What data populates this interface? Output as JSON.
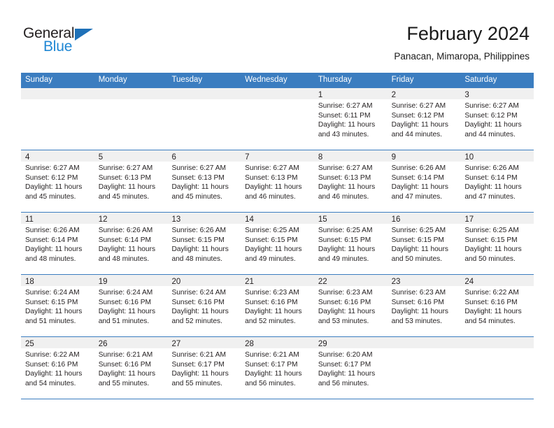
{
  "brand": {
    "name_part1": "General",
    "name_part2": "Blue",
    "triangle_color": "#1f71b8",
    "blue_color": "#1f87d4"
  },
  "header": {
    "title": "February 2024",
    "subtitle": "Panacan, Mimaropa, Philippines"
  },
  "theme": {
    "header_row_bg": "#3b7dc0",
    "day_band_bg": "#f0f0f0",
    "grid_line": "#3b7dc0",
    "text": "#231f20"
  },
  "weekdays": [
    "Sunday",
    "Monday",
    "Tuesday",
    "Wednesday",
    "Thursday",
    "Friday",
    "Saturday"
  ],
  "labels": {
    "sunrise_prefix": "Sunrise:",
    "sunset_prefix": "Sunset:",
    "daylight_prefix": "Daylight:"
  },
  "weeks": [
    [
      {
        "day": "",
        "empty": true
      },
      {
        "day": "",
        "empty": true
      },
      {
        "day": "",
        "empty": true
      },
      {
        "day": "",
        "empty": true
      },
      {
        "day": "1",
        "sunrise": "Sunrise: 6:27 AM",
        "sunset": "Sunset: 6:11 PM",
        "daylight1": "Daylight: 11 hours",
        "daylight2": "and 43 minutes."
      },
      {
        "day": "2",
        "sunrise": "Sunrise: 6:27 AM",
        "sunset": "Sunset: 6:12 PM",
        "daylight1": "Daylight: 11 hours",
        "daylight2": "and 44 minutes."
      },
      {
        "day": "3",
        "sunrise": "Sunrise: 6:27 AM",
        "sunset": "Sunset: 6:12 PM",
        "daylight1": "Daylight: 11 hours",
        "daylight2": "and 44 minutes."
      }
    ],
    [
      {
        "day": "4",
        "sunrise": "Sunrise: 6:27 AM",
        "sunset": "Sunset: 6:12 PM",
        "daylight1": "Daylight: 11 hours",
        "daylight2": "and 45 minutes."
      },
      {
        "day": "5",
        "sunrise": "Sunrise: 6:27 AM",
        "sunset": "Sunset: 6:13 PM",
        "daylight1": "Daylight: 11 hours",
        "daylight2": "and 45 minutes."
      },
      {
        "day": "6",
        "sunrise": "Sunrise: 6:27 AM",
        "sunset": "Sunset: 6:13 PM",
        "daylight1": "Daylight: 11 hours",
        "daylight2": "and 45 minutes."
      },
      {
        "day": "7",
        "sunrise": "Sunrise: 6:27 AM",
        "sunset": "Sunset: 6:13 PM",
        "daylight1": "Daylight: 11 hours",
        "daylight2": "and 46 minutes."
      },
      {
        "day": "8",
        "sunrise": "Sunrise: 6:27 AM",
        "sunset": "Sunset: 6:13 PM",
        "daylight1": "Daylight: 11 hours",
        "daylight2": "and 46 minutes."
      },
      {
        "day": "9",
        "sunrise": "Sunrise: 6:26 AM",
        "sunset": "Sunset: 6:14 PM",
        "daylight1": "Daylight: 11 hours",
        "daylight2": "and 47 minutes."
      },
      {
        "day": "10",
        "sunrise": "Sunrise: 6:26 AM",
        "sunset": "Sunset: 6:14 PM",
        "daylight1": "Daylight: 11 hours",
        "daylight2": "and 47 minutes."
      }
    ],
    [
      {
        "day": "11",
        "sunrise": "Sunrise: 6:26 AM",
        "sunset": "Sunset: 6:14 PM",
        "daylight1": "Daylight: 11 hours",
        "daylight2": "and 48 minutes."
      },
      {
        "day": "12",
        "sunrise": "Sunrise: 6:26 AM",
        "sunset": "Sunset: 6:14 PM",
        "daylight1": "Daylight: 11 hours",
        "daylight2": "and 48 minutes."
      },
      {
        "day": "13",
        "sunrise": "Sunrise: 6:26 AM",
        "sunset": "Sunset: 6:15 PM",
        "daylight1": "Daylight: 11 hours",
        "daylight2": "and 48 minutes."
      },
      {
        "day": "14",
        "sunrise": "Sunrise: 6:25 AM",
        "sunset": "Sunset: 6:15 PM",
        "daylight1": "Daylight: 11 hours",
        "daylight2": "and 49 minutes."
      },
      {
        "day": "15",
        "sunrise": "Sunrise: 6:25 AM",
        "sunset": "Sunset: 6:15 PM",
        "daylight1": "Daylight: 11 hours",
        "daylight2": "and 49 minutes."
      },
      {
        "day": "16",
        "sunrise": "Sunrise: 6:25 AM",
        "sunset": "Sunset: 6:15 PM",
        "daylight1": "Daylight: 11 hours",
        "daylight2": "and 50 minutes."
      },
      {
        "day": "17",
        "sunrise": "Sunrise: 6:25 AM",
        "sunset": "Sunset: 6:15 PM",
        "daylight1": "Daylight: 11 hours",
        "daylight2": "and 50 minutes."
      }
    ],
    [
      {
        "day": "18",
        "sunrise": "Sunrise: 6:24 AM",
        "sunset": "Sunset: 6:15 PM",
        "daylight1": "Daylight: 11 hours",
        "daylight2": "and 51 minutes."
      },
      {
        "day": "19",
        "sunrise": "Sunrise: 6:24 AM",
        "sunset": "Sunset: 6:16 PM",
        "daylight1": "Daylight: 11 hours",
        "daylight2": "and 51 minutes."
      },
      {
        "day": "20",
        "sunrise": "Sunrise: 6:24 AM",
        "sunset": "Sunset: 6:16 PM",
        "daylight1": "Daylight: 11 hours",
        "daylight2": "and 52 minutes."
      },
      {
        "day": "21",
        "sunrise": "Sunrise: 6:23 AM",
        "sunset": "Sunset: 6:16 PM",
        "daylight1": "Daylight: 11 hours",
        "daylight2": "and 52 minutes."
      },
      {
        "day": "22",
        "sunrise": "Sunrise: 6:23 AM",
        "sunset": "Sunset: 6:16 PM",
        "daylight1": "Daylight: 11 hours",
        "daylight2": "and 53 minutes."
      },
      {
        "day": "23",
        "sunrise": "Sunrise: 6:23 AM",
        "sunset": "Sunset: 6:16 PM",
        "daylight1": "Daylight: 11 hours",
        "daylight2": "and 53 minutes."
      },
      {
        "day": "24",
        "sunrise": "Sunrise: 6:22 AM",
        "sunset": "Sunset: 6:16 PM",
        "daylight1": "Daylight: 11 hours",
        "daylight2": "and 54 minutes."
      }
    ],
    [
      {
        "day": "25",
        "sunrise": "Sunrise: 6:22 AM",
        "sunset": "Sunset: 6:16 PM",
        "daylight1": "Daylight: 11 hours",
        "daylight2": "and 54 minutes."
      },
      {
        "day": "26",
        "sunrise": "Sunrise: 6:21 AM",
        "sunset": "Sunset: 6:16 PM",
        "daylight1": "Daylight: 11 hours",
        "daylight2": "and 55 minutes."
      },
      {
        "day": "27",
        "sunrise": "Sunrise: 6:21 AM",
        "sunset": "Sunset: 6:17 PM",
        "daylight1": "Daylight: 11 hours",
        "daylight2": "and 55 minutes."
      },
      {
        "day": "28",
        "sunrise": "Sunrise: 6:21 AM",
        "sunset": "Sunset: 6:17 PM",
        "daylight1": "Daylight: 11 hours",
        "daylight2": "and 56 minutes."
      },
      {
        "day": "29",
        "sunrise": "Sunrise: 6:20 AM",
        "sunset": "Sunset: 6:17 PM",
        "daylight1": "Daylight: 11 hours",
        "daylight2": "and 56 minutes."
      },
      {
        "day": "",
        "empty": true
      },
      {
        "day": "",
        "empty": true
      }
    ]
  ]
}
